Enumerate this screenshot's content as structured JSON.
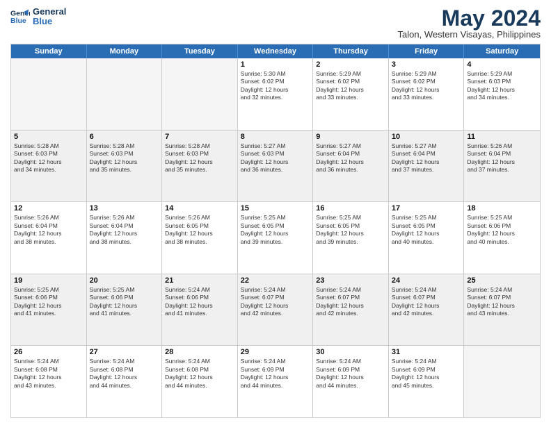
{
  "logo": {
    "line1": "General",
    "line2": "Blue"
  },
  "title": "May 2024",
  "subtitle": "Talon, Western Visayas, Philippines",
  "columns": [
    "Sunday",
    "Monday",
    "Tuesday",
    "Wednesday",
    "Thursday",
    "Friday",
    "Saturday"
  ],
  "weeks": [
    [
      {
        "num": "",
        "info": "",
        "empty": true
      },
      {
        "num": "",
        "info": "",
        "empty": true
      },
      {
        "num": "",
        "info": "",
        "empty": true
      },
      {
        "num": "1",
        "info": "Sunrise: 5:30 AM\nSunset: 6:02 PM\nDaylight: 12 hours\nand 32 minutes.",
        "empty": false
      },
      {
        "num": "2",
        "info": "Sunrise: 5:29 AM\nSunset: 6:02 PM\nDaylight: 12 hours\nand 33 minutes.",
        "empty": false
      },
      {
        "num": "3",
        "info": "Sunrise: 5:29 AM\nSunset: 6:02 PM\nDaylight: 12 hours\nand 33 minutes.",
        "empty": false
      },
      {
        "num": "4",
        "info": "Sunrise: 5:29 AM\nSunset: 6:03 PM\nDaylight: 12 hours\nand 34 minutes.",
        "empty": false
      }
    ],
    [
      {
        "num": "5",
        "info": "Sunrise: 5:28 AM\nSunset: 6:03 PM\nDaylight: 12 hours\nand 34 minutes.",
        "empty": false
      },
      {
        "num": "6",
        "info": "Sunrise: 5:28 AM\nSunset: 6:03 PM\nDaylight: 12 hours\nand 35 minutes.",
        "empty": false
      },
      {
        "num": "7",
        "info": "Sunrise: 5:28 AM\nSunset: 6:03 PM\nDaylight: 12 hours\nand 35 minutes.",
        "empty": false
      },
      {
        "num": "8",
        "info": "Sunrise: 5:27 AM\nSunset: 6:03 PM\nDaylight: 12 hours\nand 36 minutes.",
        "empty": false
      },
      {
        "num": "9",
        "info": "Sunrise: 5:27 AM\nSunset: 6:04 PM\nDaylight: 12 hours\nand 36 minutes.",
        "empty": false
      },
      {
        "num": "10",
        "info": "Sunrise: 5:27 AM\nSunset: 6:04 PM\nDaylight: 12 hours\nand 37 minutes.",
        "empty": false
      },
      {
        "num": "11",
        "info": "Sunrise: 5:26 AM\nSunset: 6:04 PM\nDaylight: 12 hours\nand 37 minutes.",
        "empty": false
      }
    ],
    [
      {
        "num": "12",
        "info": "Sunrise: 5:26 AM\nSunset: 6:04 PM\nDaylight: 12 hours\nand 38 minutes.",
        "empty": false
      },
      {
        "num": "13",
        "info": "Sunrise: 5:26 AM\nSunset: 6:04 PM\nDaylight: 12 hours\nand 38 minutes.",
        "empty": false
      },
      {
        "num": "14",
        "info": "Sunrise: 5:26 AM\nSunset: 6:05 PM\nDaylight: 12 hours\nand 38 minutes.",
        "empty": false
      },
      {
        "num": "15",
        "info": "Sunrise: 5:25 AM\nSunset: 6:05 PM\nDaylight: 12 hours\nand 39 minutes.",
        "empty": false
      },
      {
        "num": "16",
        "info": "Sunrise: 5:25 AM\nSunset: 6:05 PM\nDaylight: 12 hours\nand 39 minutes.",
        "empty": false
      },
      {
        "num": "17",
        "info": "Sunrise: 5:25 AM\nSunset: 6:05 PM\nDaylight: 12 hours\nand 40 minutes.",
        "empty": false
      },
      {
        "num": "18",
        "info": "Sunrise: 5:25 AM\nSunset: 6:06 PM\nDaylight: 12 hours\nand 40 minutes.",
        "empty": false
      }
    ],
    [
      {
        "num": "19",
        "info": "Sunrise: 5:25 AM\nSunset: 6:06 PM\nDaylight: 12 hours\nand 41 minutes.",
        "empty": false
      },
      {
        "num": "20",
        "info": "Sunrise: 5:25 AM\nSunset: 6:06 PM\nDaylight: 12 hours\nand 41 minutes.",
        "empty": false
      },
      {
        "num": "21",
        "info": "Sunrise: 5:24 AM\nSunset: 6:06 PM\nDaylight: 12 hours\nand 41 minutes.",
        "empty": false
      },
      {
        "num": "22",
        "info": "Sunrise: 5:24 AM\nSunset: 6:07 PM\nDaylight: 12 hours\nand 42 minutes.",
        "empty": false
      },
      {
        "num": "23",
        "info": "Sunrise: 5:24 AM\nSunset: 6:07 PM\nDaylight: 12 hours\nand 42 minutes.",
        "empty": false
      },
      {
        "num": "24",
        "info": "Sunrise: 5:24 AM\nSunset: 6:07 PM\nDaylight: 12 hours\nand 42 minutes.",
        "empty": false
      },
      {
        "num": "25",
        "info": "Sunrise: 5:24 AM\nSunset: 6:07 PM\nDaylight: 12 hours\nand 43 minutes.",
        "empty": false
      }
    ],
    [
      {
        "num": "26",
        "info": "Sunrise: 5:24 AM\nSunset: 6:08 PM\nDaylight: 12 hours\nand 43 minutes.",
        "empty": false
      },
      {
        "num": "27",
        "info": "Sunrise: 5:24 AM\nSunset: 6:08 PM\nDaylight: 12 hours\nand 44 minutes.",
        "empty": false
      },
      {
        "num": "28",
        "info": "Sunrise: 5:24 AM\nSunset: 6:08 PM\nDaylight: 12 hours\nand 44 minutes.",
        "empty": false
      },
      {
        "num": "29",
        "info": "Sunrise: 5:24 AM\nSunset: 6:09 PM\nDaylight: 12 hours\nand 44 minutes.",
        "empty": false
      },
      {
        "num": "30",
        "info": "Sunrise: 5:24 AM\nSunset: 6:09 PM\nDaylight: 12 hours\nand 44 minutes.",
        "empty": false
      },
      {
        "num": "31",
        "info": "Sunrise: 5:24 AM\nSunset: 6:09 PM\nDaylight: 12 hours\nand 45 minutes.",
        "empty": false
      },
      {
        "num": "",
        "info": "",
        "empty": true
      }
    ]
  ]
}
